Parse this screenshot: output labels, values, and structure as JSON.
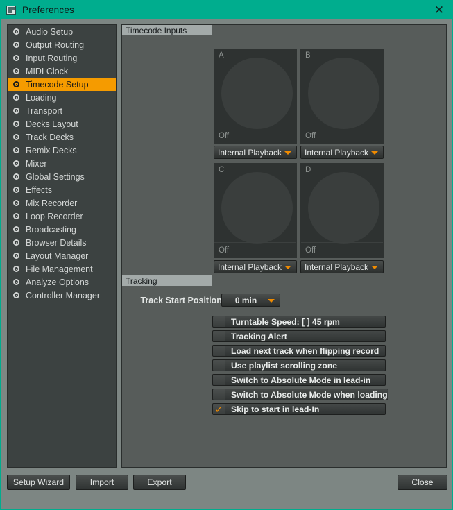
{
  "window": {
    "title": "Preferences",
    "icon": "preferences-window-icon",
    "close_icon": "✕",
    "accent_color": "#00ad8e",
    "highlight_color": "#f59b00"
  },
  "sidebar": {
    "items": [
      {
        "label": "Audio Setup",
        "selected": false
      },
      {
        "label": "Output Routing",
        "selected": false
      },
      {
        "label": "Input Routing",
        "selected": false
      },
      {
        "label": "MIDI Clock",
        "selected": false
      },
      {
        "label": "Timecode Setup",
        "selected": true
      },
      {
        "label": "Loading",
        "selected": false
      },
      {
        "label": "Transport",
        "selected": false
      },
      {
        "label": "Decks Layout",
        "selected": false
      },
      {
        "label": "Track Decks",
        "selected": false
      },
      {
        "label": "Remix Decks",
        "selected": false
      },
      {
        "label": "Mixer",
        "selected": false
      },
      {
        "label": "Global Settings",
        "selected": false
      },
      {
        "label": "Effects",
        "selected": false
      },
      {
        "label": "Mix Recorder",
        "selected": false
      },
      {
        "label": "Loop Recorder",
        "selected": false
      },
      {
        "label": "Broadcasting",
        "selected": false
      },
      {
        "label": "Browser Details",
        "selected": false
      },
      {
        "label": "Layout Manager",
        "selected": false
      },
      {
        "label": "File Management",
        "selected": false
      },
      {
        "label": "Analyze Options",
        "selected": false
      },
      {
        "label": "Controller Manager",
        "selected": false
      }
    ]
  },
  "timecode_inputs": {
    "header": "Timecode Inputs",
    "decks": [
      {
        "letter": "A",
        "status": "Off",
        "source": "Internal Playback"
      },
      {
        "letter": "B",
        "status": "Off",
        "source": "Internal Playback"
      },
      {
        "letter": "C",
        "status": "Off",
        "source": "Internal Playback"
      },
      {
        "letter": "D",
        "status": "Off",
        "source": "Internal Playback"
      }
    ]
  },
  "tracking": {
    "header": "Tracking",
    "track_start_position": {
      "label": "Track Start Position:",
      "value": "0 min"
    },
    "options": [
      {
        "label": "Turntable Speed: [ ] 45 rpm",
        "checked": false
      },
      {
        "label": "Tracking Alert",
        "checked": false
      },
      {
        "label": "Load next track when flipping record",
        "checked": false
      },
      {
        "label": "Use playlist scrolling zone",
        "checked": false
      },
      {
        "label": "Switch to Absolute Mode in lead-in",
        "checked": false
      },
      {
        "label": "Switch to Absolute Mode when loading",
        "checked": false
      },
      {
        "label": "Skip to start in lead-In",
        "checked": true
      }
    ],
    "check_mark": "✓"
  },
  "footer": {
    "setup_wizard": "Setup Wizard",
    "import": "Import",
    "export": "Export",
    "close": "Close"
  }
}
